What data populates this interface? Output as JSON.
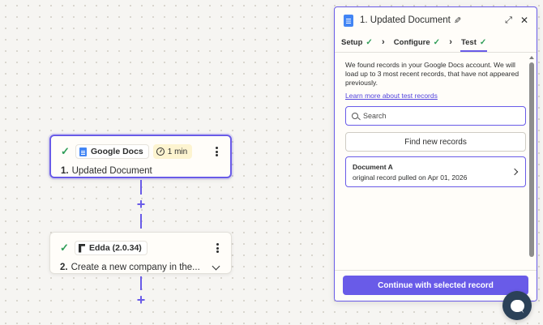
{
  "canvas": {
    "step1": {
      "app_name": "Google Docs",
      "time_label": "1 min",
      "number": "1.",
      "title": "Updated Document",
      "app_icon": "google-docs-icon",
      "status": "complete"
    },
    "step2": {
      "app_name": "Edda (2.0.34)",
      "number": "2.",
      "title": "Create a new company in the...",
      "app_icon": "edda-icon",
      "status": "complete"
    },
    "plus_symbol": "+"
  },
  "panel": {
    "title": "1. Updated Document",
    "tabs": [
      {
        "label": "Setup",
        "complete": true
      },
      {
        "label": "Configure",
        "complete": true
      },
      {
        "label": "Test",
        "complete": true,
        "active": true
      }
    ],
    "intro_text": "We found records in your Google Docs account. We will load up to 3 most recent records, that have not appeared previously.",
    "learn_link": "Learn more about test records",
    "search": {
      "placeholder": "Search",
      "value": ""
    },
    "find_button": "Find new records",
    "records": [
      {
        "title": "Document A",
        "subtitle": "original record pulled on Apr 01, 2026"
      }
    ],
    "continue_button": "Continue with selected record"
  },
  "colors": {
    "accent": "#695be8",
    "success": "#2e9d57",
    "background": "#f6f5f2",
    "chat_bubble": "#2b4158"
  },
  "icons": {
    "check": "✓",
    "chevron_right": "›"
  }
}
